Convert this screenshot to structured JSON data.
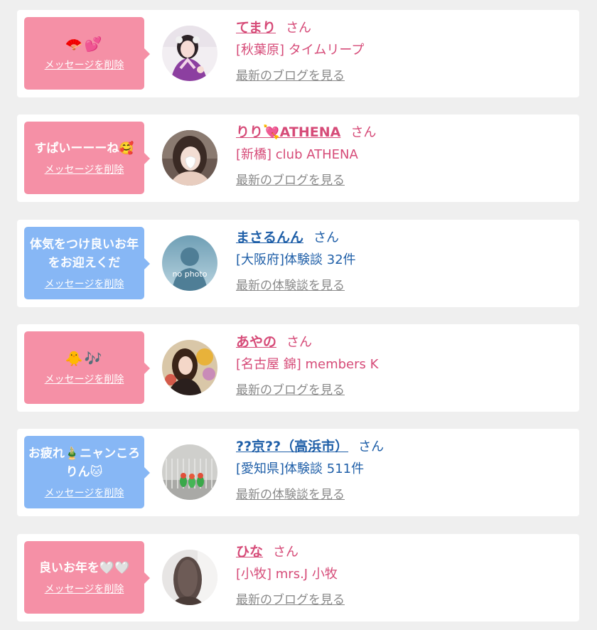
{
  "items": [
    {
      "theme": "pink",
      "message": "🪭💕",
      "message_is_emoji": true,
      "delete_label": "メッセージを削除",
      "avatar_icon": "woman-in-pink-kimono-photo",
      "name": "てまり",
      "honorific": "さん",
      "shop": "[秋葉原] タイムリープ",
      "latest_link": "最新のブログを見る"
    },
    {
      "theme": "pink",
      "message": "すぱいーーーね🥰",
      "message_is_emoji": false,
      "delete_label": "メッセージを削除",
      "avatar_icon": "woman-portrait-photo",
      "name": "りり💘ATHENA",
      "honorific": "さん",
      "shop": "[新橋] club ATHENA",
      "latest_link": "最新のブログを見る"
    },
    {
      "theme": "blue",
      "message": "体気をつけ良いお年をお迎えくだ",
      "message_is_emoji": false,
      "delete_label": "メッセージを削除",
      "avatar_icon": "no-photo-silhouette",
      "avatar_caption": "no photo",
      "name": "まさるんん",
      "honorific": "さん",
      "shop": "[大阪府]体験談 32件",
      "latest_link": "最新の体験談を見る"
    },
    {
      "theme": "pink",
      "message": "🐥🎶",
      "message_is_emoji": true,
      "delete_label": "メッセージを削除",
      "avatar_icon": "woman-with-flowers-photo",
      "name": "あやの",
      "honorific": "さん",
      "shop": "[名古屋 錦] members K",
      "latest_link": "最新のブログを見る"
    },
    {
      "theme": "blue",
      "message": "お疲れ🎍ニャンころりん🐱",
      "message_is_emoji": false,
      "delete_label": "メッセージを削除",
      "avatar_icon": "parrots-in-cage-photo",
      "name": "??京??（高浜市）",
      "honorific": "さん",
      "shop": "[愛知県]体験談 511件",
      "latest_link": "最新の体験談を見る"
    },
    {
      "theme": "pink",
      "message": "良いお年を🤍🤍",
      "message_is_emoji": false,
      "delete_label": "メッセージを削除",
      "avatar_icon": "woman-back-hair-photo",
      "name": "ひな",
      "honorific": "さん",
      "shop": "[小牧] mrs.J 小牧",
      "latest_link": "最新のブログを見る"
    }
  ],
  "colors": {
    "pink_bubble": "#f590a6",
    "blue_bubble": "#87b7f5",
    "pink_text": "#d64b78",
    "blue_text": "#1f5fa8",
    "link_gray": "#8a8a8a",
    "background": "#efefef"
  }
}
